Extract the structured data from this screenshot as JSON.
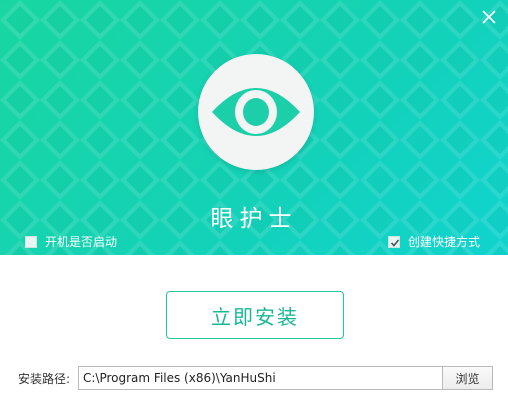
{
  "window": {
    "close_icon": "close-icon"
  },
  "banner": {
    "title": "眼护士",
    "logo_icon": "eye-icon",
    "gradient_colors": [
      "#19d6a1",
      "#10d3cf"
    ]
  },
  "options": {
    "autostart": {
      "label": "开机是否启动",
      "checked": false
    },
    "shortcut": {
      "label": "创建快捷方式",
      "checked": true
    }
  },
  "install": {
    "button_label": "立即安装",
    "accent_color": "#1ab896"
  },
  "path": {
    "label": "安装路径:",
    "value": "C:\\Program Files (x86)\\YanHuShi",
    "browse_label": "浏览"
  }
}
